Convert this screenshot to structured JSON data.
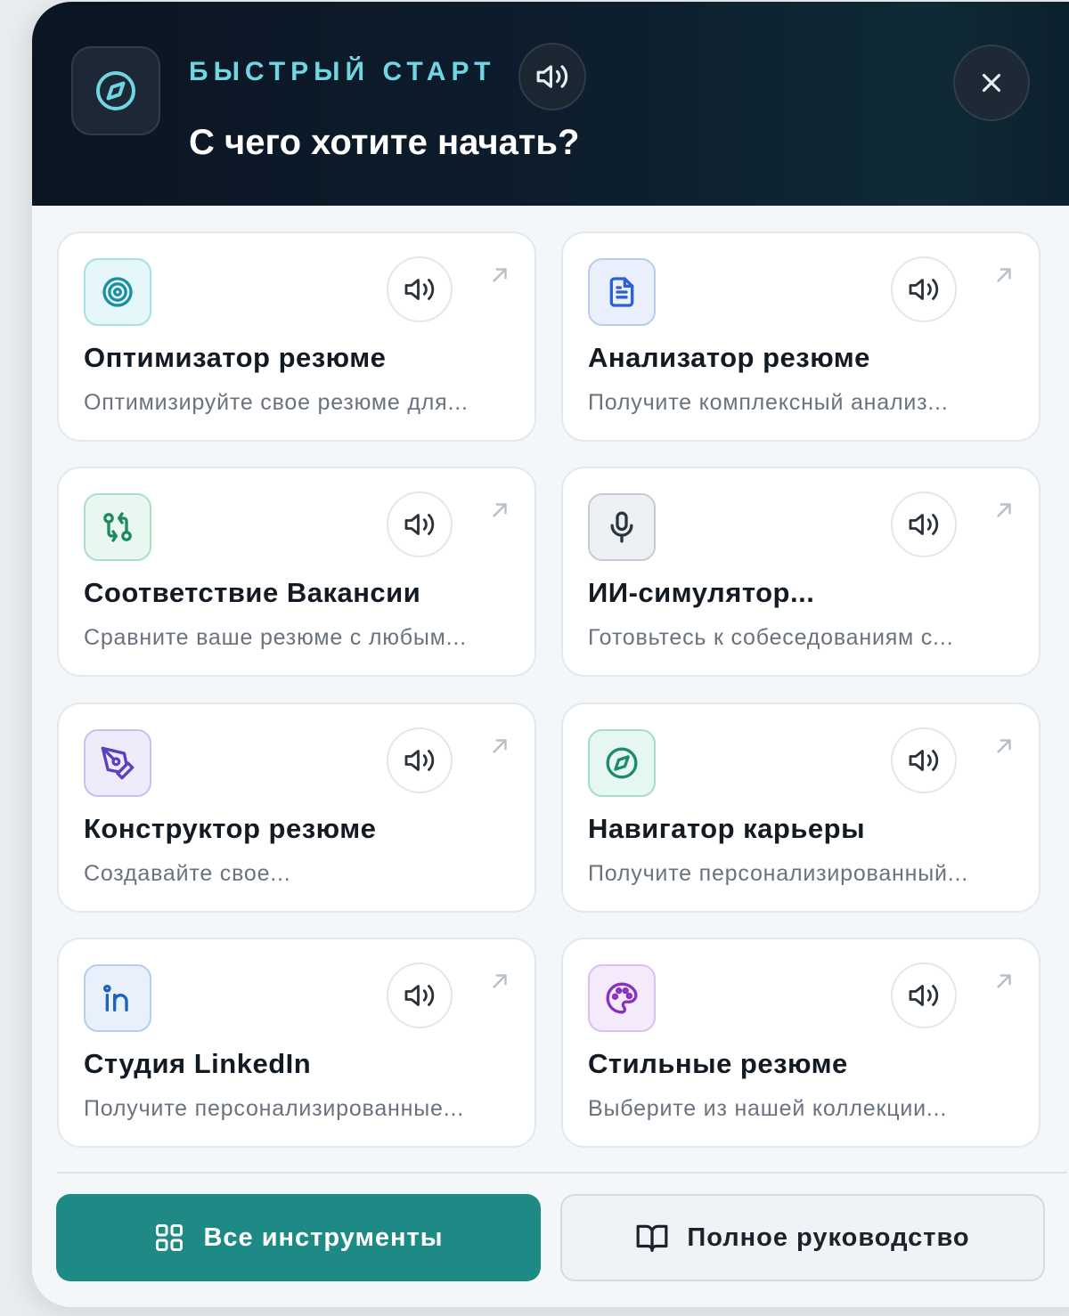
{
  "header": {
    "eyebrow": "БЫСТРЫЙ СТАРТ",
    "title": "С чего хотите начать?"
  },
  "cards": [
    {
      "title": "Оптимизатор резюме",
      "desc": "Оптимизируйте свое резюме для...",
      "icon": "target-icon",
      "color": "#1b8ea0",
      "bg": "#e6f7f9",
      "border": "#a8e0e6"
    },
    {
      "title": "Анализатор резюме",
      "desc": "Получите комплексный анализ...",
      "icon": "document-icon",
      "color": "#2f5fd0",
      "bg": "#eaf0fb",
      "border": "#b9cbee"
    },
    {
      "title": "Соответствие Вакансии",
      "desc": "Сравните ваше резюме с любым...",
      "icon": "git-compare-icon",
      "color": "#1f8a5c",
      "bg": "#e8f7ef",
      "border": "#a9e0c4"
    },
    {
      "title": "ИИ-симулятор...",
      "desc": "Готовьтесь к собеседованиям с...",
      "icon": "microphone-icon",
      "color": "#2d3640",
      "bg": "#eef1f4",
      "border": "#c5ccd3"
    },
    {
      "title": "Конструктор резюме",
      "desc": "Создавайте свое...",
      "icon": "pen-tool-icon",
      "color": "#5a3fc0",
      "bg": "#eeebfb",
      "border": "#c9c0f0"
    },
    {
      "title": "Навигатор карьеры",
      "desc": "Получите персонализированный...",
      "icon": "compass-icon",
      "color": "#1b8a6e",
      "bg": "#e6f7f1",
      "border": "#a6ddc9"
    },
    {
      "title": "Студия LinkedIn",
      "desc": "Получите персонализированные...",
      "icon": "linkedin-icon",
      "color": "#1e63b8",
      "bg": "#e8f1fb",
      "border": "#b6cdec"
    },
    {
      "title": "Стильные резюме",
      "desc": "Выберите из нашей коллекции...",
      "icon": "palette-icon",
      "color": "#8a2fc4",
      "bg": "#f4eafb",
      "border": "#dcc0f0"
    }
  ],
  "buttons": {
    "all_tools": "Все инструменты",
    "full_guide": "Полное руководство"
  },
  "colors": {
    "accent": "#1e8a86",
    "eyebrow": "#6fd6e2",
    "header_bg": "#0b1523"
  }
}
